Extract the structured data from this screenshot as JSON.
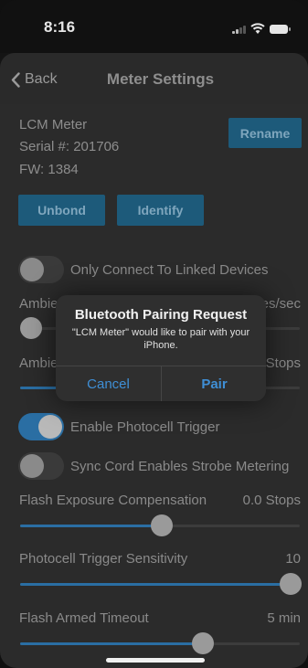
{
  "status_bar": {
    "time": "8:16"
  },
  "nav": {
    "back_label": "Back",
    "title": "Meter Settings"
  },
  "device": {
    "name": "LCM Meter",
    "serial": "Serial #: 201706",
    "firmware": "FW: 1384",
    "rename_label": "Rename",
    "unbond_label": "Unbond",
    "identify_label": "Identify"
  },
  "settings": {
    "only_linked": {
      "label": "Only Connect To Linked Devices",
      "on": false
    },
    "ambient_rate": {
      "label_partial": "Ambie",
      "value_partial": "es/sec",
      "level": 0.0
    },
    "ambient_stops": {
      "label_partial": "Ambie",
      "value_partial": "Stops"
    },
    "photocell_trigger": {
      "label": "Enable Photocell Trigger",
      "on": true
    },
    "sync_cord": {
      "label": "Sync Cord Enables Strobe Metering",
      "on": false
    },
    "flash_comp": {
      "label": "Flash Exposure Compensation",
      "value": "0.0 Stops",
      "level": 0.5
    },
    "photocell_sensitivity": {
      "label": "Photocell Trigger Sensitivity",
      "value": "10",
      "level": 1.0
    },
    "flash_timeout": {
      "label": "Flash Armed Timeout",
      "value": "5 min",
      "level": 0.66
    }
  },
  "dialog": {
    "title": "Bluetooth Pairing Request",
    "message": "\"LCM Meter\" would like to pair with your iPhone.",
    "cancel_label": "Cancel",
    "pair_label": "Pair"
  },
  "colors": {
    "accent": "#2a6ea3",
    "dialog_button": "#3f8fd6",
    "button_bg": "#1d5a7a"
  }
}
